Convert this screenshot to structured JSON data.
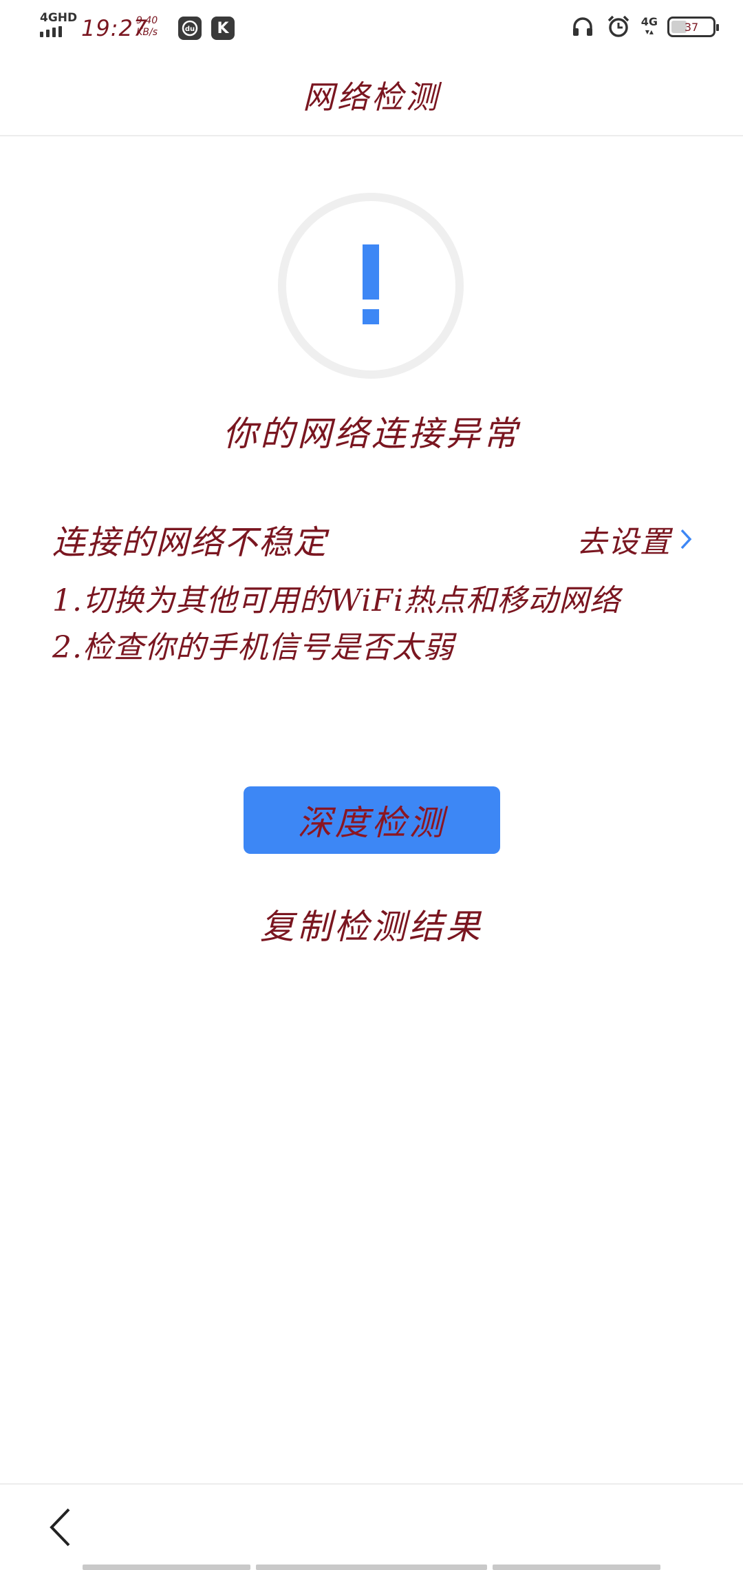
{
  "status_bar": {
    "network": "4GHD",
    "time": "19:27",
    "speed_value": "9.40",
    "speed_unit": "KB/s",
    "app_icons": [
      "du-app-icon",
      "k-app-icon"
    ],
    "right_network": "4G",
    "battery": "37",
    "battery_level": 0.37
  },
  "header": {
    "title": "网络检测"
  },
  "main": {
    "alert_icon": "exclamation-icon",
    "accent_color": "#3d87f5",
    "headline": "你的网络连接异常",
    "issue": {
      "title": "连接的网络不稳定",
      "action_label": "去设置"
    },
    "tips": [
      "1.切换为其他可用的WiFi热点和移动网络",
      "2.检查你的手机信号是否太弱"
    ],
    "primary_button": "深度检测",
    "secondary_link": "复制检测结果"
  },
  "bottom_bar": {
    "back_icon": "chevron-left-icon"
  }
}
